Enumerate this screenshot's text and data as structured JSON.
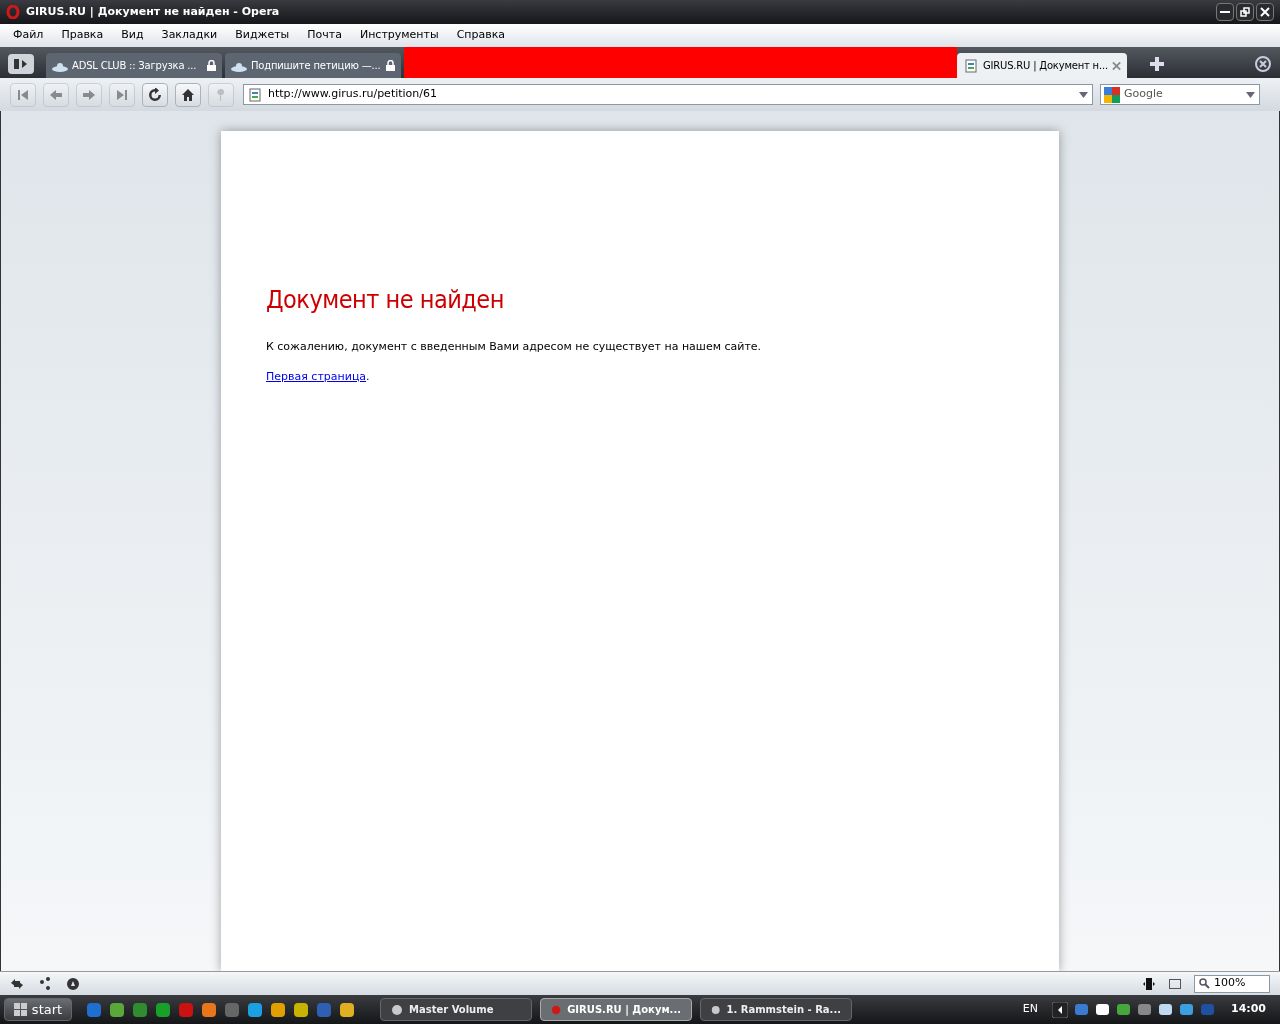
{
  "window": {
    "title": "GIRUS.RU | Документ не найден - Opera"
  },
  "menu": [
    "Файл",
    "Правка",
    "Вид",
    "Закладки",
    "Виджеты",
    "Почта",
    "Инструменты",
    "Справка"
  ],
  "tabs": [
    {
      "label": "ADSL CLUB :: Загрузка ...",
      "selected": false,
      "locked": true
    },
    {
      "label": "Подпишите петицию —...",
      "selected": false,
      "locked": true
    },
    {
      "label": "GIRUS.RU | Документ н...",
      "selected": true,
      "locked": false
    }
  ],
  "address": {
    "value": "http://www.girus.ru/petition/61"
  },
  "search": {
    "placeholder": "Google"
  },
  "page": {
    "heading": "Документ не найден",
    "message": "К сожалению, документ с введенным Вами адресом не существует на нашем сайте.",
    "link": "Первая страница",
    "link_suffix": "."
  },
  "status_bar": {
    "zoom": "100%"
  },
  "taskbar": {
    "start": "start",
    "tasks": [
      {
        "label": "Master Volume",
        "selected": false
      },
      {
        "label": "GIRUS.RU | Докум...",
        "selected": true
      },
      {
        "label": "1. Rammstein - Ra...",
        "selected": false
      }
    ],
    "language": "EN",
    "clock": "14:00"
  }
}
